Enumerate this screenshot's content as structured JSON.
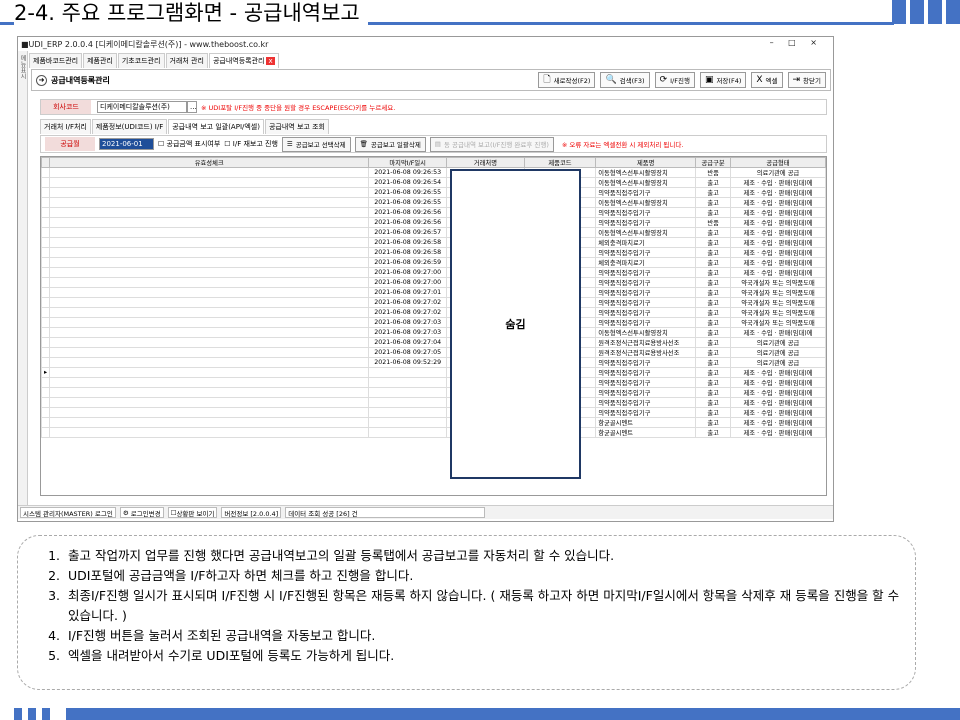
{
  "slide": {
    "title": "2-4. 주요 프로그램화면 - 공급내역보고",
    "accent": "#4472c4"
  },
  "window": {
    "title": "■UDI_ERP 2.0.0.4 [디케이메디칼솔루션(주)] - www.theboost.co.kr",
    "controls": "– □ ×",
    "side_label": "메뉴표시",
    "tabs": [
      "제품바코드관리",
      "제품관리",
      "기초코드관리",
      "거래처 관리",
      "공급내역등록관리"
    ],
    "close_icon": "close-icon",
    "page_title": "공급내역등록관리",
    "toolbar": [
      {
        "icon": "new-doc-icon",
        "label": "새로작성(F2)"
      },
      {
        "icon": "search-icon",
        "label": "검색(F3)"
      },
      {
        "icon": "refresh-icon",
        "label": "I/F진행"
      },
      {
        "icon": "save-icon",
        "label": "저장(F4)"
      },
      {
        "icon": "excel-icon",
        "label": "엑셀"
      },
      {
        "icon": "exit-icon",
        "label": "창닫기"
      }
    ],
    "corp_label": "회사코드",
    "corp_value": "디케이메디칼솔루션(주)",
    "corp_btn": "...",
    "corp_warning": "※ UDI포탈 I/F진행 중 중단을 원할 경우 ESCAPE(ESC)키를 누르세요.",
    "sub_tabs": [
      "거래처 I/F처리",
      "제품정보(UDI코드) I/F",
      "공급내역 보고 일괄(API/엑셀)",
      "공급내역 보고 조회"
    ],
    "date_label": "공급월",
    "date_value": "2021-06-01",
    "chk_amount": "공급금액 표시여부",
    "chk_report": "I/F 재보고 진행",
    "btn_select_delete": "공급보고 선택삭제",
    "btn_bulk_delete": "공급보고 일괄삭제",
    "btn_disabled": "동 공급내역 보고(I/F진행 완료후 진행)",
    "ctrl_warning": "※ 오류 자료는 엑셀전환 시 제외처리 됩니다.",
    "columns": [
      "유효성체크",
      "마지막I/F일시",
      "거래처명",
      "제품코드",
      "제품명",
      "공급구분",
      "공급형태"
    ],
    "hidden_text": "숨김",
    "rows": [
      [
        "2021-06-08 09:26:53",
        "이동형엑스선투시촬영장치",
        "반품",
        "의료기관에 공급"
      ],
      [
        "2021-06-08 09:26:54",
        "이동형엑스선투시촬영장치",
        "출고",
        "제조 · 수입 · 판매(임대)에"
      ],
      [
        "2021-06-08 09:26:55",
        "의약품직접주입기구",
        "출고",
        "제조 · 수입 · 판매(임대)에"
      ],
      [
        "2021-06-08 09:26:55",
        "이동형엑스선투시촬영장치",
        "출고",
        "제조 · 수입 · 판매(임대)에"
      ],
      [
        "2021-06-08 09:26:56",
        "의약품직접주입기구",
        "출고",
        "제조 · 수입 · 판매(임대)에"
      ],
      [
        "2021-06-08 09:26:56",
        "의약품직접주입기구",
        "반품",
        "제조 · 수입 · 판매(임대)에"
      ],
      [
        "2021-06-08 09:26:57",
        "이동형엑스선투시촬영장치",
        "출고",
        "제조 · 수입 · 판매(임대)에"
      ],
      [
        "2021-06-08 09:26:58",
        "체외충격파치료기",
        "출고",
        "제조 · 수입 · 판매(임대)에"
      ],
      [
        "2021-06-08 09:26:58",
        "의약품직접주입기구",
        "출고",
        "제조 · 수입 · 판매(임대)에"
      ],
      [
        "2021-06-08 09:26:59",
        "체외충격파치료기",
        "출고",
        "제조 · 수입 · 판매(임대)에"
      ],
      [
        "2021-06-08 09:27:00",
        "의약품직접주입기구",
        "출고",
        "제조 · 수입 · 판매(임대)에"
      ],
      [
        "2021-06-08 09:27:00",
        "의약품직접주입기구",
        "출고",
        "약국개설자 또는 의약품도매"
      ],
      [
        "2021-06-08 09:27:01",
        "의약품직접주입기구",
        "출고",
        "약국개설자 또는 의약품도매"
      ],
      [
        "2021-06-08 09:27:02",
        "의약품직접주입기구",
        "출고",
        "약국개설자 또는 의약품도매"
      ],
      [
        "2021-06-08 09:27:02",
        "의약품직접주입기구",
        "출고",
        "약국개설자 또는 의약품도매"
      ],
      [
        "2021-06-08 09:27:03",
        "의약품직접주입기구",
        "출고",
        "약국개설자 또는 의약품도매"
      ],
      [
        "2021-06-08 09:27:03",
        "이동형엑스선투시촬영장치",
        "출고",
        "제조 · 수입 · 판매(임대)에"
      ],
      [
        "2021-06-08 09:27:04",
        "원격조정식근접치료용방사선조",
        "출고",
        "의료기관에 공급"
      ],
      [
        "2021-06-08 09:27:05",
        "원격조정식근접치료용방사선조",
        "출고",
        "의료기관에 공급"
      ],
      [
        "2021-06-08 09:52:29",
        "의약품직접주입기구",
        "출고",
        "의료기관에 공급"
      ],
      [
        "",
        "의약품직접주입기구",
        "출고",
        "제조 · 수입 · 판매(임대)에"
      ],
      [
        "",
        "의약품직접주입기구",
        "출고",
        "제조 · 수입 · 판매(임대)에"
      ],
      [
        "",
        "의약품직접주입기구",
        "출고",
        "제조 · 수입 · 판매(임대)에"
      ],
      [
        "",
        "의약품직접주입기구",
        "출고",
        "제조 · 수입 · 판매(임대)에"
      ],
      [
        "",
        "의약품직접주입기구",
        "출고",
        "제조 · 수입 · 판매(임대)에"
      ],
      [
        "",
        "항균골시멘트",
        "출고",
        "제조 · 수입 · 판매(임대)에"
      ],
      [
        "",
        "항균골시멘트",
        "출고",
        "제조 · 수입 · 판매(임대)에"
      ]
    ],
    "status": {
      "user": "시스템 관리자(MASTER) 로그인",
      "logout": "로그인변경",
      "chk_status": "상황판 보이기",
      "version": "버전정보 [2.0.0.4]",
      "message": "데이터 조회 성공 [26] 건"
    }
  },
  "notes": [
    "출고 작업까지 업무를 진행 했다면 공급내역보고의 일괄 등록탭에서 공급보고를 자동처리 할 수 있습니다.",
    "UDI포털에 공급금액을 I/F하고자 하면 체크를 하고 진행을 합니다.",
    "최종I/F진행 일시가 표시되며 I/F진행 시 I/F진행된 항목은 재등록 하지 않습니다. ( 재등록 하고자 하면 마지막I/F일시에서 항목을 삭제후 재 등록을 진행을 할 수 있습니다. )",
    "I/F진행 버튼을 눌러서 조회된 공급내역을 자동보고 합니다.",
    "엑셀을 내려받아서 수기로 UDI포털에 등록도 가능하게 됩니다."
  ]
}
